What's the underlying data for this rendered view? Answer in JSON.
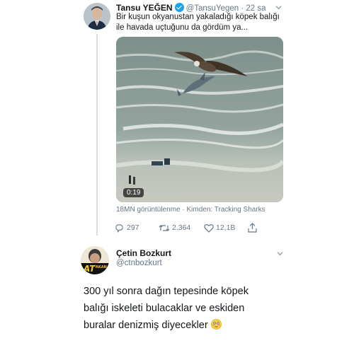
{
  "tweet1": {
    "name": "Tansu YEĞEN",
    "handle_time": "@TansuYegen · 22 sa",
    "text_line1": "Bir kuşun okyanustan yakaladığı köpek balığı",
    "text_line2": "ile havada uçtuğunu da gördüm ya...",
    "video_duration": "0:19",
    "views_source": "18MN görüntülenme · Kimden: Tracking Sharks",
    "stats": {
      "replies": "297",
      "retweets": "2.364",
      "likes": "12,1B"
    }
  },
  "tweet2": {
    "name": "Çetin Bozkurt",
    "handle": "@ctnbozkurt",
    "avatar_text": "ATAKAN",
    "text_line1": "300 yıl sonra dağın tepesinde köpek",
    "text_line2": "balığı iskeleti bulacaklar ve eskiden",
    "text_line3": "buralar denizmiş diyecekler"
  },
  "colors": {
    "verified": "#1da1f2",
    "text": "#14171a",
    "secondary": "#657786",
    "thread_line": "#d9dde2"
  },
  "icons": [
    "verified-badge-icon",
    "chevron-down-icon",
    "reply-icon",
    "retweet-icon",
    "like-icon",
    "share-icon",
    "flushed-emoji-icon"
  ]
}
